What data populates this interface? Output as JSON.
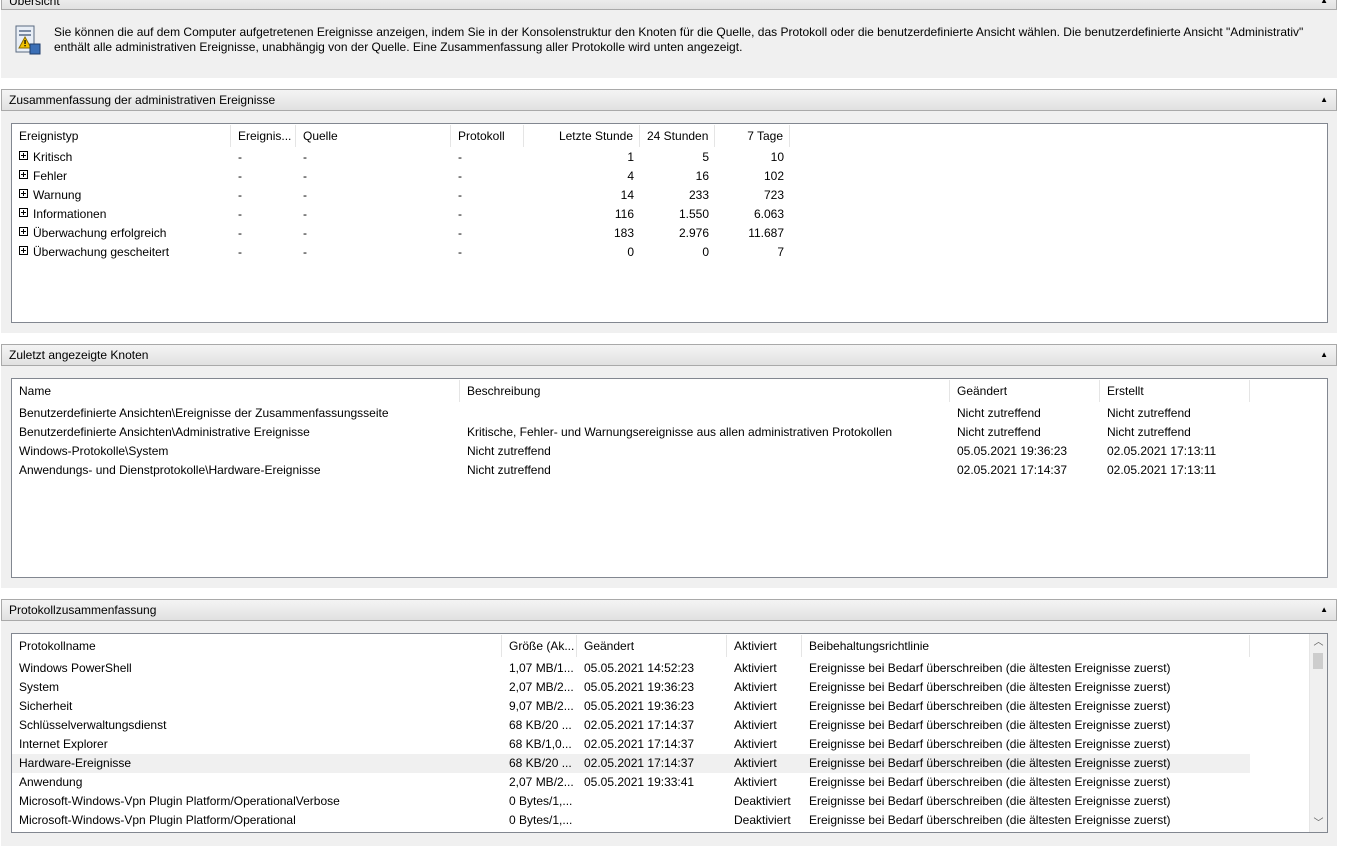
{
  "overview": {
    "title": "Übersicht",
    "text_line1": "Sie können die auf dem Computer aufgetretenen Ereignisse anzeigen, indem Sie in der Konsolenstruktur den Knoten für die Quelle, das Protokoll oder die benutzerdefinierte Ansicht wählen. Die benutzerdefinierte Ansicht \"Administrativ\"",
    "text_line2": "enthält alle administrativen Ereignisse, unabhängig von der Quelle. Eine Zusammenfassung aller Protokolle wird unten angezeigt."
  },
  "admin_summary": {
    "title": "Zusammenfassung der administrativen Ereignisse",
    "columns": [
      "Ereignistyp",
      "Ereignis...",
      "Quelle",
      "Protokoll",
      "Letzte Stunde",
      "24 Stunden",
      "7 Tage"
    ],
    "rows": [
      {
        "type": "Kritisch",
        "id": "-",
        "source": "-",
        "log": "-",
        "hour": "1",
        "day": "5",
        "week": "10"
      },
      {
        "type": "Fehler",
        "id": "-",
        "source": "-",
        "log": "-",
        "hour": "4",
        "day": "16",
        "week": "102"
      },
      {
        "type": "Warnung",
        "id": "-",
        "source": "-",
        "log": "-",
        "hour": "14",
        "day": "233",
        "week": "723"
      },
      {
        "type": "Informationen",
        "id": "-",
        "source": "-",
        "log": "-",
        "hour": "116",
        "day": "1.550",
        "week": "6.063"
      },
      {
        "type": "Überwachung erfolgreich",
        "id": "-",
        "source": "-",
        "log": "-",
        "hour": "183",
        "day": "2.976",
        "week": "11.687"
      },
      {
        "type": "Überwachung gescheitert",
        "id": "-",
        "source": "-",
        "log": "-",
        "hour": "0",
        "day": "0",
        "week": "7"
      }
    ]
  },
  "recent_nodes": {
    "title": "Zuletzt angezeigte Knoten",
    "columns": [
      "Name",
      "Beschreibung",
      "Geändert",
      "Erstellt"
    ],
    "rows": [
      {
        "name": "Benutzerdefinierte Ansichten\\Ereignisse der Zusammenfassungsseite",
        "desc": "",
        "changed": "Nicht zutreffend",
        "created": "Nicht zutreffend"
      },
      {
        "name": "Benutzerdefinierte Ansichten\\Administrative Ereignisse",
        "desc": "Kritische, Fehler- und Warnungsereignisse aus allen administrativen Protokollen",
        "changed": "Nicht zutreffend",
        "created": "Nicht zutreffend"
      },
      {
        "name": "Windows-Protokolle\\System",
        "desc": "Nicht zutreffend",
        "changed": "05.05.2021 19:36:23",
        "created": "02.05.2021 17:13:11"
      },
      {
        "name": "Anwendungs- und Dienstprotokolle\\Hardware-Ereignisse",
        "desc": "Nicht zutreffend",
        "changed": "02.05.2021 17:14:37",
        "created": "02.05.2021 17:13:11"
      }
    ]
  },
  "log_summary": {
    "title": "Protokollzusammenfassung",
    "columns": [
      "Protokollname",
      "Größe (Ak...",
      "Geändert",
      "Aktiviert",
      "Beibehaltungsrichtlinie"
    ],
    "rows": [
      {
        "name": "Windows PowerShell",
        "size": "1,07 MB/1...",
        "changed": "05.05.2021 14:52:23",
        "enabled": "Aktiviert",
        "policy": "Ereignisse bei Bedarf überschreiben (die ältesten Ereignisse zuerst)"
      },
      {
        "name": "System",
        "size": "2,07 MB/2...",
        "changed": "05.05.2021 19:36:23",
        "enabled": "Aktiviert",
        "policy": "Ereignisse bei Bedarf überschreiben (die ältesten Ereignisse zuerst)"
      },
      {
        "name": "Sicherheit",
        "size": "9,07 MB/2...",
        "changed": "05.05.2021 19:36:23",
        "enabled": "Aktiviert",
        "policy": "Ereignisse bei Bedarf überschreiben (die ältesten Ereignisse zuerst)"
      },
      {
        "name": "Schlüsselverwaltungsdienst",
        "size": "68 KB/20 ...",
        "changed": "02.05.2021 17:14:37",
        "enabled": "Aktiviert",
        "policy": "Ereignisse bei Bedarf überschreiben (die ältesten Ereignisse zuerst)"
      },
      {
        "name": "Internet Explorer",
        "size": "68 KB/1,0...",
        "changed": "02.05.2021 17:14:37",
        "enabled": "Aktiviert",
        "policy": "Ereignisse bei Bedarf überschreiben (die ältesten Ereignisse zuerst)"
      },
      {
        "name": "Hardware-Ereignisse",
        "size": "68 KB/20 ...",
        "changed": "02.05.2021 17:14:37",
        "enabled": "Aktiviert",
        "policy": "Ereignisse bei Bedarf überschreiben (die ältesten Ereignisse zuerst)"
      },
      {
        "name": "Anwendung",
        "size": "2,07 MB/2...",
        "changed": "05.05.2021 19:33:41",
        "enabled": "Aktiviert",
        "policy": "Ereignisse bei Bedarf überschreiben (die ältesten Ereignisse zuerst)"
      },
      {
        "name": "Microsoft-Windows-Vpn Plugin Platform/OperationalVerbose",
        "size": "0 Bytes/1,...",
        "changed": "",
        "enabled": "Deaktiviert",
        "policy": "Ereignisse bei Bedarf überschreiben (die ältesten Ereignisse zuerst)"
      },
      {
        "name": "Microsoft-Windows-Vpn Plugin Platform/Operational",
        "size": "0 Bytes/1,...",
        "changed": "",
        "enabled": "Deaktiviert",
        "policy": "Ereignisse bei Bedarf überschreiben (die ältesten Ereignisse zuerst)"
      }
    ],
    "selected_row": "Hardware-Ereignisse"
  },
  "icons": {
    "collapse": "chevron-up-icon",
    "expand": "plus-box-icon",
    "overview": "event-log-icon"
  },
  "colors": {
    "header_border": "#a9a9a9",
    "panel_bg": "#f0f0f0",
    "list_border": "#828790",
    "selected_row": "#f0f0f0"
  }
}
